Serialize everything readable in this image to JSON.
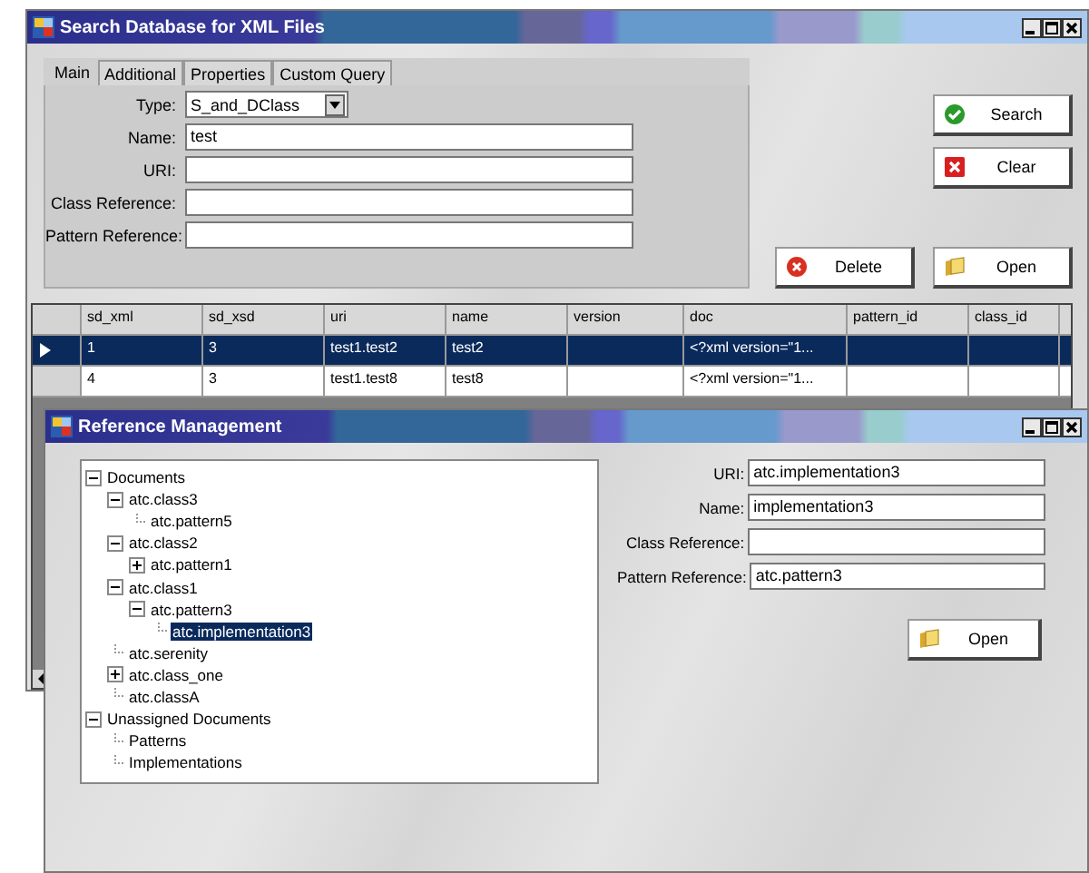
{
  "search_window": {
    "title": "Search Database for XML Files",
    "tabs": [
      {
        "label": "Main",
        "selected": true
      },
      {
        "label": "Additional",
        "selected": false
      },
      {
        "label": "Properties",
        "selected": false
      },
      {
        "label": "Custom Query",
        "selected": false
      }
    ],
    "fields": [
      {
        "label": "Type:",
        "kind": "dropdown",
        "value": "S_and_DClass"
      },
      {
        "label": "Name:",
        "kind": "text",
        "value": "test"
      },
      {
        "label": "URI:",
        "kind": "text"
      },
      {
        "label": "Class Reference:",
        "kind": "text"
      },
      {
        "label": "Pattern Reference:",
        "kind": "text"
      }
    ],
    "buttons": {
      "search": "Search",
      "clear": "Clear",
      "delete": "Delete",
      "open": "Open"
    },
    "table": {
      "columns": [
        "sd_xml",
        "sd_xsd",
        "uri",
        "name",
        "version",
        "doc",
        "pattern_id",
        "class_id"
      ],
      "rows": [
        {
          "selected": true,
          "cells": [
            "1",
            "3",
            "test1.test2",
            "test2",
            null,
            "<?xml version=\"1...",
            null,
            null
          ]
        },
        {
          "selected": false,
          "cells": [
            "4",
            "3",
            "test1.test8",
            "test8",
            null,
            "<?xml version=\"1...",
            null,
            null
          ]
        }
      ]
    }
  },
  "reference_window": {
    "title": "Reference Management",
    "tree": [
      {
        "label": "Documents",
        "expanded": true,
        "selected": false,
        "children": [
          {
            "label": "atc.class3",
            "expanded": true,
            "selected": false,
            "children": [
              {
                "label": "atc.pattern5",
                "selected": false
              }
            ]
          },
          {
            "label": "atc.class2",
            "expanded": true,
            "selected": false,
            "children": [
              {
                "label": "atc.pattern1",
                "expanded": false,
                "selected": false
              }
            ]
          },
          {
            "label": "atc.class1",
            "expanded": true,
            "selected": false,
            "children": [
              {
                "label": "atc.pattern3",
                "expanded": true,
                "selected": false,
                "children": [
                  {
                    "label": "atc.implementation3",
                    "selected": true
                  }
                ]
              }
            ]
          },
          {
            "label": "atc.serenity",
            "selected": false
          },
          {
            "label": "atc.class_one",
            "expanded": false,
            "selected": false
          },
          {
            "label": "atc.classA",
            "selected": false
          }
        ]
      },
      {
        "label": "Unassigned Documents",
        "expanded": true,
        "selected": false,
        "children": [
          {
            "label": "Patterns",
            "selected": false
          },
          {
            "label": "Implementations",
            "selected": false
          }
        ]
      }
    ],
    "fields": [
      {
        "label": "URI:",
        "value": "atc.implementation3"
      },
      {
        "label": "Name:",
        "value": "implementation3"
      },
      {
        "label": "Class Reference:"
      },
      {
        "label": "Pattern Reference:",
        "value": "atc.pattern3"
      }
    ],
    "open_button": "Open"
  }
}
